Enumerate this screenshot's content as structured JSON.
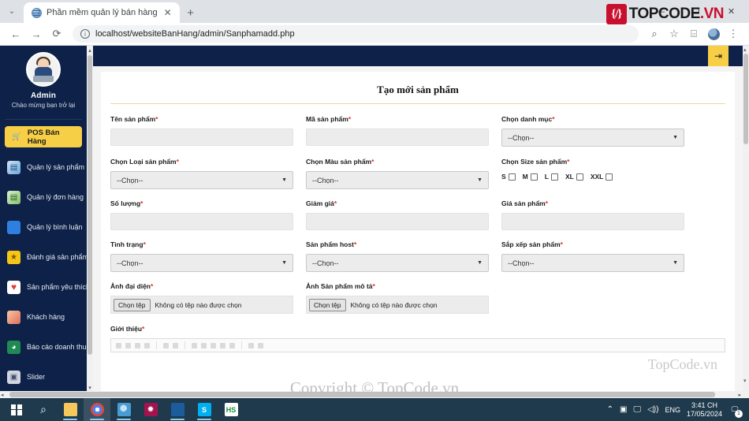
{
  "browser": {
    "tab_title": "Phần mềm quản lý bán hàng",
    "tab_close": "✕",
    "new_tab": "+",
    "tab_list_chevron": "⌄",
    "back": "←",
    "forward": "→",
    "reload": "⟳",
    "info_icon": "i",
    "url": "localhost/websiteBanHang/admin/Sanphamadd.php",
    "zoom_icon": "⌕",
    "star_icon": "☆",
    "extensions_icon": "⌸",
    "menu_icon": "⋮",
    "minimize": "—",
    "maximize": "❐",
    "close": "✕"
  },
  "logo": {
    "mark": "{/}",
    "text_main": "TOPCODE",
    "text_suffix": ".VN"
  },
  "sidebar": {
    "name": "Admin",
    "welcome": "Chào mừng bạn trở lại",
    "pos_button": "POS Bán Hàng",
    "pos_icon": "🛒",
    "items": [
      {
        "label": "Quản lý sản phẩm",
        "icon": "product-icon",
        "glyph": "▤"
      },
      {
        "label": "Quản lý đơn hàng",
        "icon": "order-icon",
        "glyph": "▤"
      },
      {
        "label": "Quản lý bình luận",
        "icon": "comment-icon",
        "glyph": "💬"
      },
      {
        "label": "Đánh giá sản phẩm",
        "icon": "review-icon",
        "glyph": "★"
      },
      {
        "label": "Sản phẩm yêu thích",
        "icon": "favorite-icon",
        "glyph": "♥"
      },
      {
        "label": "Khách hàng",
        "icon": "customer-icon",
        "glyph": "☻"
      },
      {
        "label": "Báo cáo doanh thu",
        "icon": "revenue-icon",
        "glyph": "◕"
      },
      {
        "label": "Slider",
        "icon": "slider-icon",
        "glyph": "▣"
      }
    ]
  },
  "topbar": {
    "logout_icon": "⇥"
  },
  "form": {
    "title": "Tạo mới sản phẩm",
    "select_placeholder": "--Chọn--",
    "file_button": "Chọn tệp",
    "file_status": "Không có tệp nào được chọn",
    "fields": {
      "ten_san_pham": "Tên sản phẩm",
      "ma_san_pham": "Mã sản phẩm",
      "chon_danh_muc": "Chọn danh mục",
      "chon_loai_san_pham": "Chọn Loại sản phẩm",
      "chon_mau_san_pham": "Chọn Màu sản phẩm",
      "chon_size_san_pham": "Chọn Size sản phẩm",
      "so_luong": "Số lượng",
      "giam_gia": "Giảm giá",
      "gia_san_pham": "Giá sản phẩm",
      "tinh_trang": "Tình trạng",
      "san_pham_host": "Sản phẩm host",
      "sap_xep_san_pham": "Sắp xếp sản phẩm",
      "anh_dai_dien": "Ảnh đại diện",
      "anh_san_pham_mo_ta": "Ảnh Sản phẩm mô tả",
      "gioi_thieu": "Giới thiệu"
    },
    "required_mark": "*",
    "sizes": [
      "S",
      "M",
      "L",
      "XL",
      "XXL"
    ]
  },
  "watermarks": {
    "card": "TopCode.vn",
    "copyright": "Copyright © TopCode.vn"
  },
  "taskbar": {
    "search_icon": "⌕",
    "apps": [
      {
        "name": "file-explorer",
        "glyph": ""
      },
      {
        "name": "chrome",
        "glyph": ""
      },
      {
        "name": "xampp",
        "glyph": ""
      },
      {
        "name": "app-pink",
        "glyph": ""
      },
      {
        "name": "app-blue",
        "glyph": ""
      },
      {
        "name": "skype",
        "glyph": "S"
      },
      {
        "name": "hs-app",
        "glyph": "HS"
      }
    ],
    "tray": {
      "chevron": "⌃",
      "camera_icon": "▣",
      "display_icon": "🖵",
      "volume_icon": "◁))",
      "language": "ENG",
      "time": "3:41 CH",
      "date": "17/05/2024",
      "notification_count": "1"
    }
  },
  "colors": {
    "sidebar_bg": "#0d2149",
    "accent_yellow": "#f7cf46",
    "brand_red": "#c8102e",
    "required_red": "#d93025"
  }
}
